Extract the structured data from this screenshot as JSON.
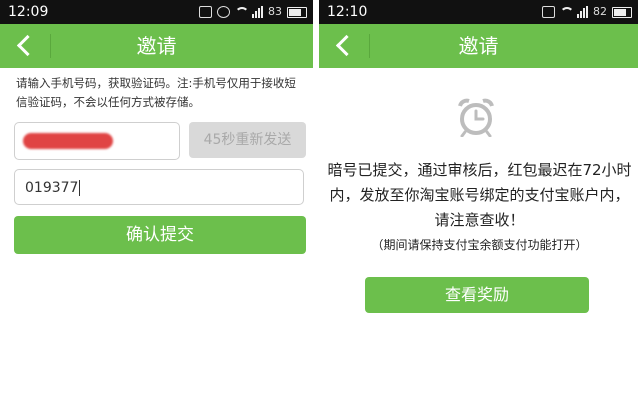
{
  "left": {
    "status": {
      "time": "12:09",
      "battery": "83"
    },
    "title": "邀请",
    "instructions": "请输入手机号码，获取验证码。注:手机号仅用于接收短信验证码，不会以任何方式被存储。",
    "phone_input": {
      "value": ""
    },
    "resend_button": "45秒重新发送",
    "code_input": {
      "value": "019377"
    },
    "submit_button": "确认提交"
  },
  "right": {
    "status": {
      "time": "12:10",
      "battery": "82"
    },
    "title": "邀请",
    "message": "暗号已提交，通过审核后，红包最迟在72小时内，发放至你淘宝账号绑定的支付宝账户内，请注意查收！",
    "note": "（期间请保持支付宝余额支付功能打开）",
    "reward_button": "查看奖励"
  },
  "colors": {
    "accent": "#6cbf4c",
    "statusbar": "#111111",
    "disabled": "#d9d9d9"
  },
  "icons": [
    "back-arrow-icon",
    "alarm-clock-icon",
    "wifi-icon",
    "signal-icon",
    "battery-icon"
  ]
}
